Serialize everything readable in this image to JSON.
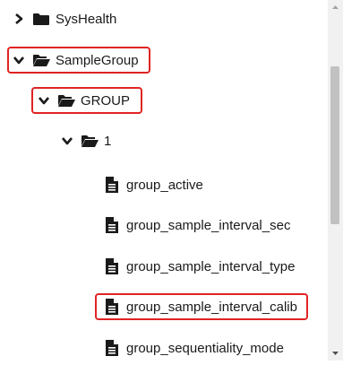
{
  "tree": {
    "items": [
      {
        "label": "SysHealth",
        "type": "folder",
        "state": "collapsed",
        "level": 0
      },
      {
        "label": "SampleGroup",
        "type": "folder",
        "state": "expanded",
        "level": 0,
        "highlighted": true
      },
      {
        "label": "GROUP",
        "type": "folder",
        "state": "expanded",
        "level": 1,
        "highlighted": true
      },
      {
        "label": "1",
        "type": "folder",
        "state": "expanded",
        "level": 2
      },
      {
        "label": "group_active",
        "type": "file",
        "level": 3
      },
      {
        "label": "group_sample_interval_sec",
        "type": "file",
        "level": 3
      },
      {
        "label": "group_sample_interval_type",
        "type": "file",
        "level": 3
      },
      {
        "label": "group_sample_interval_calib",
        "type": "file",
        "level": 3,
        "highlighted": true
      },
      {
        "label": "group_sequentiality_mode",
        "type": "file",
        "level": 3
      }
    ]
  },
  "colors": {
    "highlight": "#e02424",
    "icon": "#1a1a1a",
    "scrollbar_track": "#f1f1f1",
    "scrollbar_thumb": "#c1c1c1"
  },
  "icons": {
    "collapsed": "chevron-right-icon",
    "expanded": "chevron-down-icon",
    "folder_closed": "folder-icon",
    "folder_open": "folder-open-icon",
    "file": "file-icon"
  }
}
